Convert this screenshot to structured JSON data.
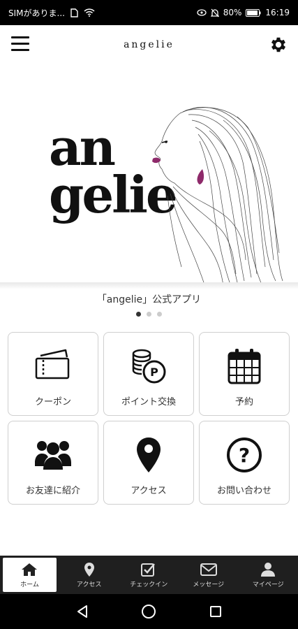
{
  "status_bar": {
    "carrier": "SIMがありま...",
    "battery": "80%",
    "time": "16:19"
  },
  "header": {
    "title": "angelie",
    "menu_icon": "hamburger-menu-icon",
    "settings_icon": "gear-icon"
  },
  "hero": {
    "logo_line1": "an",
    "logo_line2": "gelie",
    "caption": "「angelie」公式アプリ",
    "slides": 3,
    "active_slide": 1
  },
  "tiles": [
    {
      "label": "クーポン",
      "icon": "ticket-icon"
    },
    {
      "label": "ポイント交換",
      "icon": "coins-icon"
    },
    {
      "label": "予約",
      "icon": "calendar-icon"
    },
    {
      "label": "お友達に紹介",
      "icon": "users-icon"
    },
    {
      "label": "アクセス",
      "icon": "map-pin-icon"
    },
    {
      "label": "お問い合わせ",
      "icon": "question-icon"
    }
  ],
  "tabs": [
    {
      "label": "ホーム",
      "icon": "home-icon",
      "active": true
    },
    {
      "label": "アクセス",
      "icon": "map-pin-icon",
      "active": false
    },
    {
      "label": "チェックイン",
      "icon": "checkin-icon",
      "active": false
    },
    {
      "label": "メッセージ",
      "icon": "mail-icon",
      "active": false
    },
    {
      "label": "マイページ",
      "icon": "user-icon",
      "active": false
    }
  ],
  "colors": {
    "accent_lip": "#8e2a6a",
    "tabbar_bg": "#1f1f1f"
  }
}
